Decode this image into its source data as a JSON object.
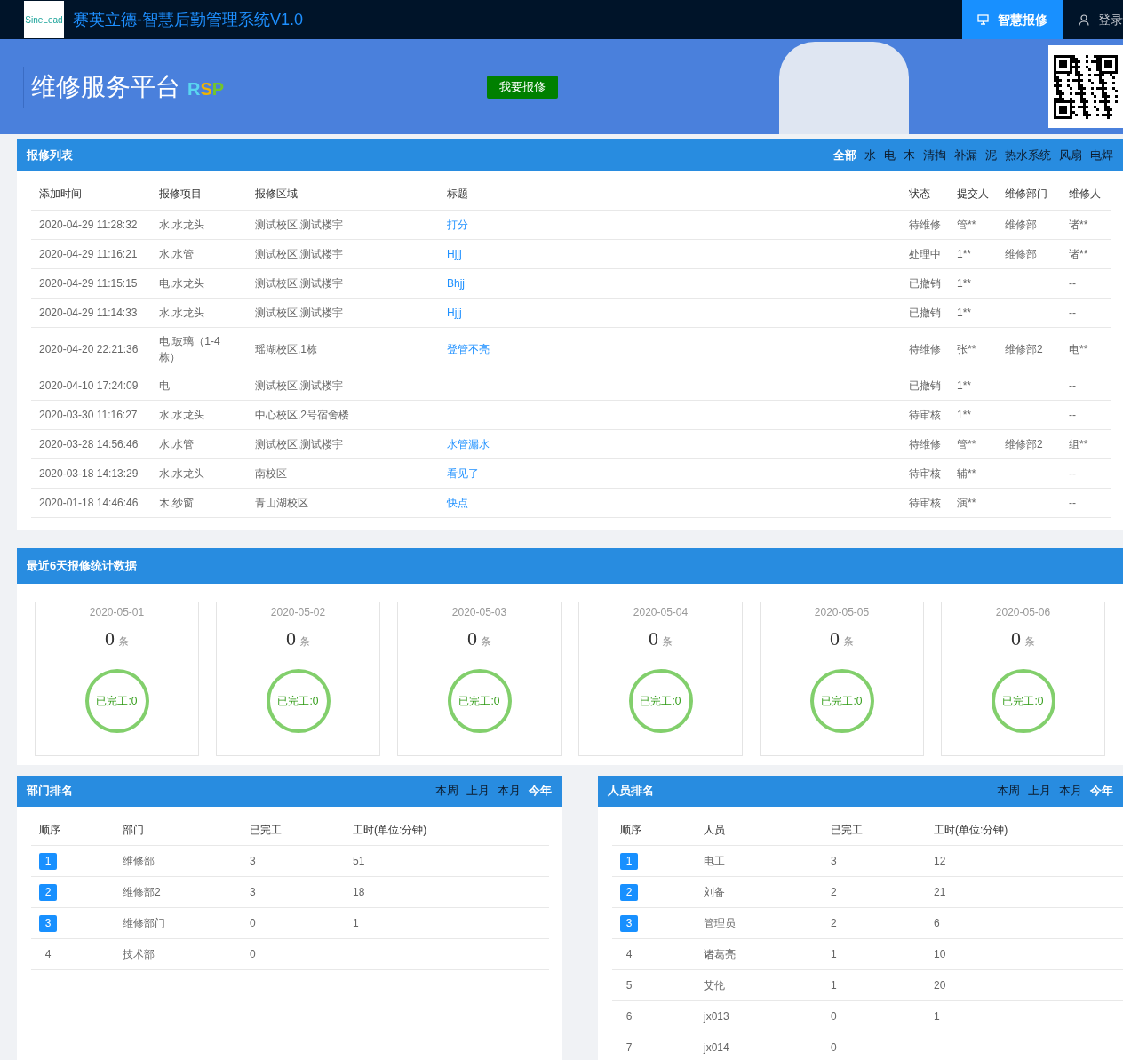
{
  "top_bar": {
    "logo": "SineLead",
    "title": "赛英立德-智慧后勤管理系统V1.0",
    "nav": [
      {
        "label": "智慧报修",
        "selected": true
      },
      {
        "label": "登录",
        "selected": false
      }
    ]
  },
  "banner": {
    "title": "维修服务平台",
    "badge": "RSP",
    "button": "我要报修"
  },
  "repair_list": {
    "title": "报修列表",
    "filters": [
      {
        "label": "全部",
        "selected": true
      },
      {
        "label": "水",
        "selected": false
      },
      {
        "label": "电",
        "selected": false
      },
      {
        "label": "木",
        "selected": false
      },
      {
        "label": "清掏",
        "selected": false
      },
      {
        "label": "补漏",
        "selected": false
      },
      {
        "label": "泥",
        "selected": false
      },
      {
        "label": "热水系统",
        "selected": false
      },
      {
        "label": "风扇",
        "selected": false
      },
      {
        "label": "电焊",
        "selected": false
      }
    ],
    "columns": [
      "添加时间",
      "报修项目",
      "报修区域",
      "标题",
      "状态",
      "提交人",
      "维修部门",
      "维修人"
    ],
    "rows": [
      [
        "2020-04-29 11:28:32",
        "水,水龙头",
        "测试校区,测试楼宇",
        "打分",
        "待维修",
        "管**",
        "维修部",
        "诸**"
      ],
      [
        "2020-04-29 11:16:21",
        "水,水管",
        "测试校区,测试楼宇",
        "Hjjj",
        "处理中",
        "1**",
        "维修部",
        "诸**"
      ],
      [
        "2020-04-29 11:15:15",
        "电,水龙头",
        "测试校区,测试楼宇",
        "Bhjj",
        "已撤销",
        "1**",
        "",
        "--"
      ],
      [
        "2020-04-29 11:14:33",
        "水,水龙头",
        "测试校区,测试楼宇",
        "Hjjj",
        "已撤销",
        "1**",
        "",
        "--"
      ],
      [
        "2020-04-20 22:21:36",
        "电,玻璃（1-4栋）",
        "瑶湖校区,1栋",
        "登管不亮",
        "待维修",
        "张**",
        "维修部2",
        "电**"
      ],
      [
        "2020-04-10 17:24:09",
        "电",
        "测试校区,测试楼宇",
        "",
        "已撤销",
        "1**",
        "",
        "--"
      ],
      [
        "2020-03-30 11:16:27",
        "水,水龙头",
        "中心校区,2号宿舍楼",
        "",
        "待审核",
        "1**",
        "",
        "--"
      ],
      [
        "2020-03-28 14:56:46",
        "水,水管",
        "测试校区,测试楼宇",
        "水管漏水",
        "待维修",
        "管**",
        "维修部2",
        "组**"
      ],
      [
        "2020-03-18 14:13:29",
        "水,水龙头",
        "南校区",
        "看见了",
        "待审核",
        "辅**",
        "",
        "--"
      ],
      [
        "2020-01-18 14:46:46",
        "木,纱窗",
        "青山湖校区",
        "快点",
        "待审核",
        "演**",
        "",
        "--"
      ]
    ]
  },
  "stats": {
    "title": "最近6天报修统计数据",
    "days": [
      {
        "date": "2020-05-01",
        "count": "0",
        "unit": "条",
        "done": "已完工:0"
      },
      {
        "date": "2020-05-02",
        "count": "0",
        "unit": "条",
        "done": "已完工:0"
      },
      {
        "date": "2020-05-03",
        "count": "0",
        "unit": "条",
        "done": "已完工:0"
      },
      {
        "date": "2020-05-04",
        "count": "0",
        "unit": "条",
        "done": "已完工:0"
      },
      {
        "date": "2020-05-05",
        "count": "0",
        "unit": "条",
        "done": "已完工:0"
      },
      {
        "date": "2020-05-06",
        "count": "0",
        "unit": "条",
        "done": "已完工:0"
      }
    ]
  },
  "rankings": [
    {
      "title": "部门排名",
      "periods": [
        {
          "label": "本周",
          "selected": false
        },
        {
          "label": "上月",
          "selected": false
        },
        {
          "label": "本月",
          "selected": false
        },
        {
          "label": "今年",
          "selected": true
        }
      ],
      "columns": [
        "顺序",
        "部门",
        "已完工",
        "工时(单位:分钟)"
      ],
      "rows": [
        {
          "badge": true,
          "cells": [
            "1",
            "维修部",
            "3",
            "51"
          ]
        },
        {
          "badge": true,
          "cells": [
            "2",
            "维修部2",
            "3",
            "18"
          ]
        },
        {
          "badge": true,
          "cells": [
            "3",
            "维修部门",
            "0",
            "1"
          ]
        },
        {
          "badge": false,
          "cells": [
            "4",
            "技术部",
            "0",
            ""
          ]
        }
      ]
    },
    {
      "title": "人员排名",
      "periods": [
        {
          "label": "本周",
          "selected": false
        },
        {
          "label": "上月",
          "selected": false
        },
        {
          "label": "本月",
          "selected": false
        },
        {
          "label": "今年",
          "selected": true
        }
      ],
      "columns": [
        "顺序",
        "人员",
        "已完工",
        "工时(单位:分钟)"
      ],
      "rows": [
        {
          "badge": true,
          "cells": [
            "1",
            "电工",
            "3",
            "12"
          ]
        },
        {
          "badge": true,
          "cells": [
            "2",
            "刘备",
            "2",
            "21"
          ]
        },
        {
          "badge": true,
          "cells": [
            "3",
            "管理员",
            "2",
            "6"
          ]
        },
        {
          "badge": false,
          "cells": [
            "4",
            "诸葛亮",
            "1",
            "10"
          ]
        },
        {
          "badge": false,
          "cells": [
            "5",
            "艾伦",
            "1",
            "20"
          ]
        },
        {
          "badge": false,
          "cells": [
            "6",
            "jx013",
            "0",
            "1"
          ]
        },
        {
          "badge": false,
          "cells": [
            "7",
            "jx014",
            "0",
            ""
          ]
        }
      ]
    }
  ]
}
